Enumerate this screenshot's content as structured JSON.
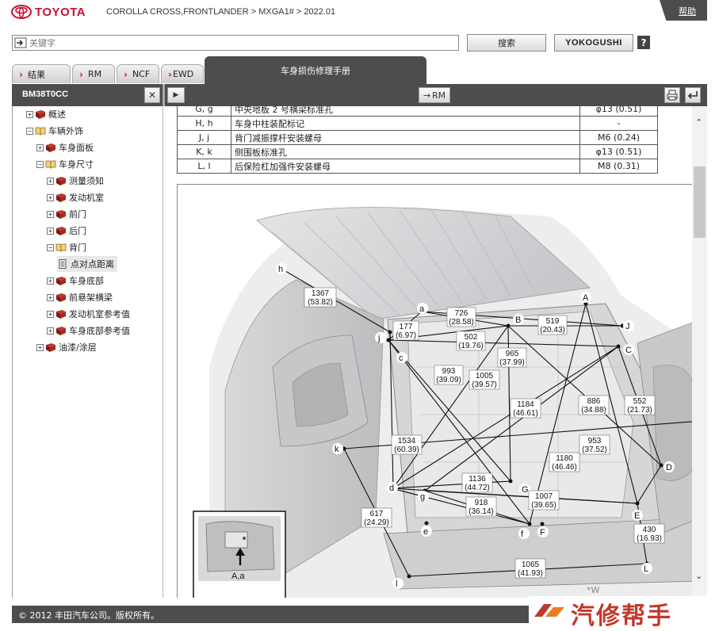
{
  "header": {
    "brand": "TOYOTA",
    "breadcrumb": "COROLLA CROSS,FRONTLANDER > MXGA1# > 2022.01",
    "help_label": "帮助"
  },
  "search": {
    "placeholder": "关键字",
    "search_label": "搜索",
    "yokogushi_label": "YOKOGUSHI",
    "question_label": "?"
  },
  "tabs": [
    {
      "label": "结果"
    },
    {
      "label": "RM"
    },
    {
      "label": "NCF"
    },
    {
      "label": "EWD"
    }
  ],
  "active_tab": "车身损伤修理手册",
  "left_panel": {
    "title": "BM38T0CC"
  },
  "toolbar": {
    "rm_label": "RM"
  },
  "tree": [
    {
      "label": "概述",
      "expander": "+",
      "icon": "book-closed"
    },
    {
      "label": "车辆外饰",
      "expander": "−",
      "icon": "book-open"
    },
    {
      "label": "车身面板",
      "expander": "+",
      "icon": "book-closed"
    },
    {
      "label": "车身尺寸",
      "expander": "−",
      "icon": "book-open"
    },
    {
      "label": "测量须知",
      "expander": "+",
      "icon": "book-closed"
    },
    {
      "label": "发动机室",
      "expander": "+",
      "icon": "book-closed"
    },
    {
      "label": "前门",
      "expander": "+",
      "icon": "book-closed"
    },
    {
      "label": "后门",
      "expander": "+",
      "icon": "book-closed"
    },
    {
      "label": "背门",
      "expander": "−",
      "icon": "book-open"
    },
    {
      "label": "点对点距离",
      "expander": "",
      "icon": "document"
    },
    {
      "label": "车身底部",
      "expander": "+",
      "icon": "book-closed"
    },
    {
      "label": "前悬架横梁",
      "expander": "+",
      "icon": "book-closed"
    },
    {
      "label": "发动机室参考值",
      "expander": "+",
      "icon": "book-closed"
    },
    {
      "label": "车身底部参考值",
      "expander": "+",
      "icon": "book-closed"
    },
    {
      "label": "油漆/涂层",
      "expander": "+",
      "icon": "book-closed"
    }
  ],
  "table_rows": [
    {
      "code": "G, g",
      "desc": "中央地板 2 号横梁标准孔",
      "spec": "φ13 (0.51)"
    },
    {
      "code": "H, h",
      "desc": "车身中柱装配标记",
      "spec": "-"
    },
    {
      "code": "J, j",
      "desc": "背门减振撑杆安装螺母",
      "spec": "M6 (0.24)"
    },
    {
      "code": "K, k",
      "desc": "侧围板标准孔",
      "spec": "φ13 (0.51)"
    },
    {
      "code": "L, l",
      "desc": "后保险杠加强件安装螺母",
      "spec": "M8 (0.31)"
    }
  ],
  "figure": {
    "points": [
      "A",
      "B",
      "C",
      "D",
      "E",
      "F",
      "G",
      "J",
      "L",
      "a",
      "c",
      "d",
      "e",
      "f",
      "g",
      "h",
      "j",
      "k",
      "l"
    ],
    "dimensions": [
      {
        "mm": "1367",
        "inch": "(53.82)"
      },
      {
        "mm": "726",
        "inch": "(28.58)"
      },
      {
        "mm": "519",
        "inch": "(20.43)"
      },
      {
        "mm": "177",
        "inch": "(6.97)"
      },
      {
        "mm": "502",
        "inch": "(19.76)"
      },
      {
        "mm": "965",
        "inch": "(37.99)"
      },
      {
        "mm": "993",
        "inch": "(39.09)"
      },
      {
        "mm": "1005",
        "inch": "(39.57)"
      },
      {
        "mm": "886",
        "inch": "(34.88)"
      },
      {
        "mm": "552",
        "inch": "(21.73)"
      },
      {
        "mm": "1184",
        "inch": "(46.61)"
      },
      {
        "mm": "1534",
        "inch": "(60.39)"
      },
      {
        "mm": "953",
        "inch": "(37.52)"
      },
      {
        "mm": "1180",
        "inch": "(46.46)"
      },
      {
        "mm": "1136",
        "inch": "(44.72)"
      },
      {
        "mm": "918",
        "inch": "(36.14)"
      },
      {
        "mm": "1007",
        "inch": "(39.65)"
      },
      {
        "mm": "617",
        "inch": "(24.29)"
      },
      {
        "mm": "430",
        "inch": "(16.93)"
      },
      {
        "mm": "1065",
        "inch": "(41.93)"
      }
    ],
    "inset_label": "A,a",
    "corner_mark": "*W"
  },
  "footer": {
    "copyright": "© 2012 丰田汽车公司。版权所有。"
  },
  "watermark": {
    "text": "汽修帮手"
  }
}
